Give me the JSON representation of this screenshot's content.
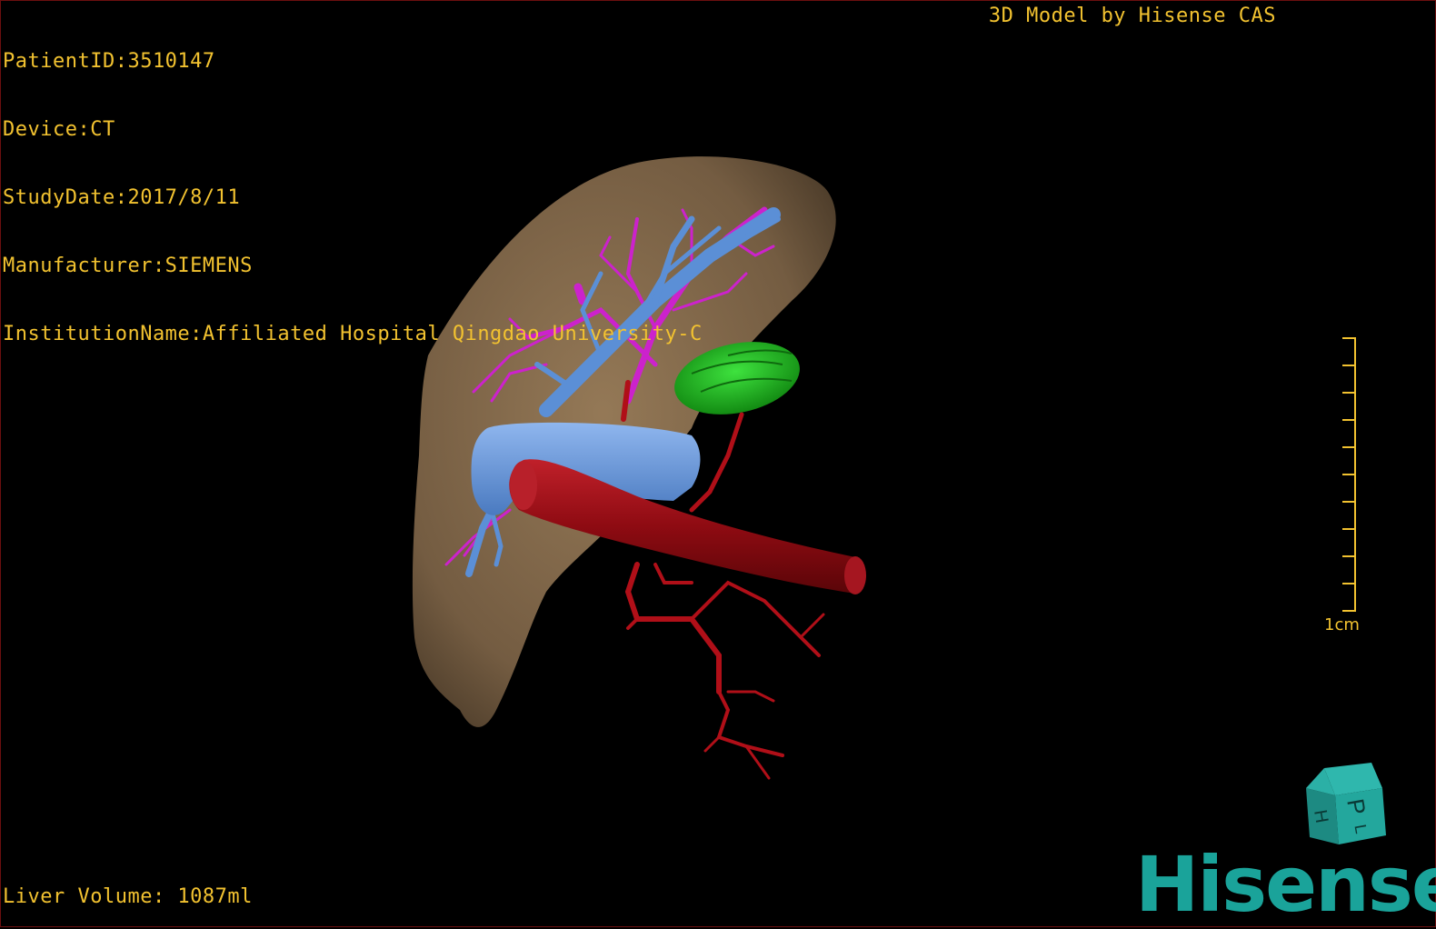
{
  "overlay": {
    "patient_id": "PatientID:3510147",
    "device": "Device:CT",
    "study_date": "StudyDate:2017/8/11",
    "manufacturer": "Manufacturer:SIEMENS",
    "institution": "InstitutionName:Affiliated Hospital Qingdao University-C",
    "credit": "3D Model by Hisense CAS",
    "liver_volume": "Liver Volume: 1087ml"
  },
  "scale": {
    "label": "1cm"
  },
  "orientation_cube": {
    "face_letters": [
      "P",
      "H",
      "L"
    ]
  },
  "brand": {
    "logo_text": "Hisense",
    "logo_color": "#1aa39a"
  },
  "colors": {
    "text": "#f2c230",
    "liver": "#8a7050",
    "portal_vein": "#5b8fd6",
    "hepatic_artery": "#c10f1a",
    "biliary": "#cc22cc",
    "gallbladder": "#1fb51f"
  },
  "structures": [
    "liver",
    "portal-vein",
    "hepatic-artery",
    "biliary-tree",
    "gallbladder",
    "aorta"
  ]
}
